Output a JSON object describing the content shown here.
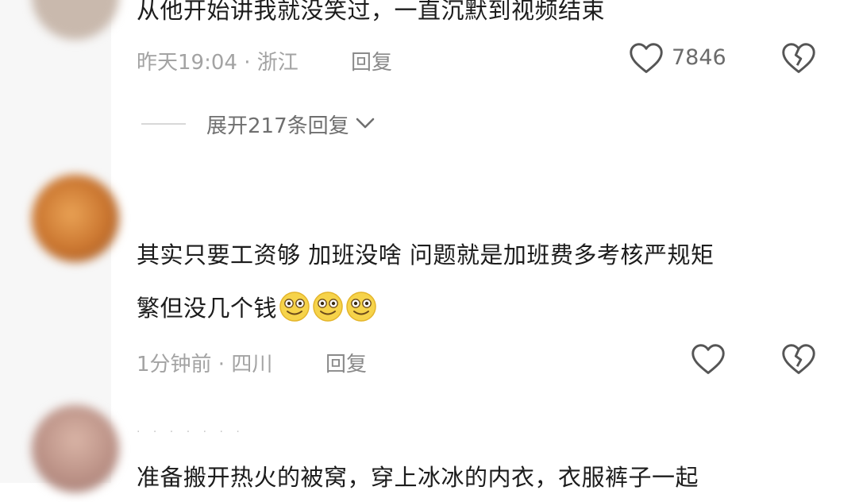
{
  "comments": [
    {
      "text": "从他开始讲我就没笑过，一直沉默到视频结束",
      "time_location": "昨天19:04 · 浙江",
      "reply_label": "回复",
      "like_count": "7846"
    },
    {
      "text_line1": "其实只要工资够 加班没啥 问题就是加班费多考核严规矩",
      "text_line2": "繁但没几个钱",
      "time_location": "1分钟前 · 四川",
      "reply_label": "回复"
    },
    {
      "text": "准备搬开热火的被窝，穿上冰冰的内衣，衣服裤子一起"
    }
  ],
  "expand_replies": "展开217条回复",
  "icons": [
    "heart-outline-icon",
    "broken-heart-icon",
    "chevron-down-icon",
    "smile-emoji-icon"
  ]
}
